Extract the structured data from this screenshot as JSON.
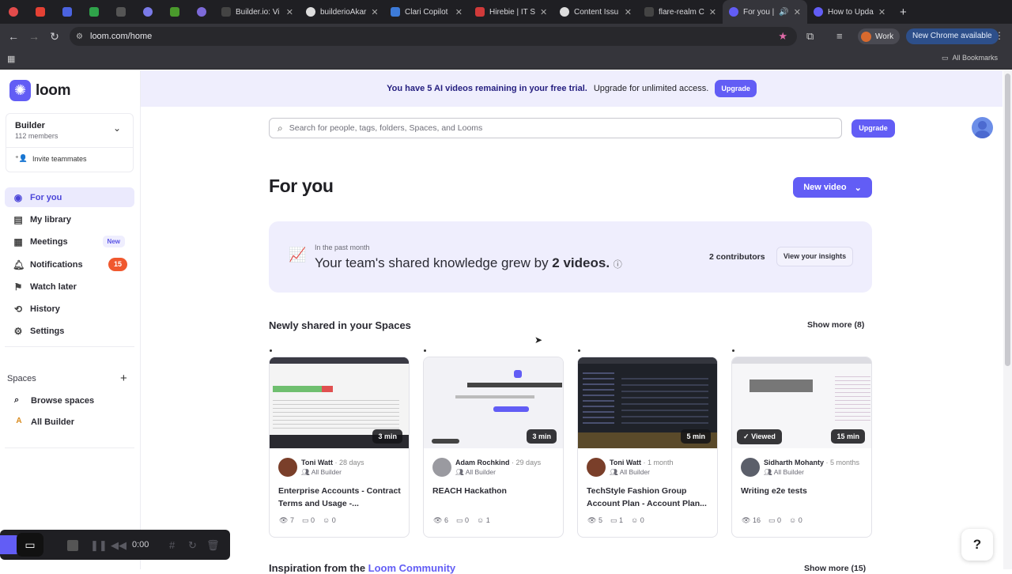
{
  "browser": {
    "tabs": [
      {
        "label": "",
        "color": "#e34b4b"
      },
      {
        "label": "",
        "color": "#e44134"
      },
      {
        "label": "",
        "color": "#4b63e0"
      },
      {
        "label": "",
        "color": "#2fa34a"
      },
      {
        "label": "",
        "color": "#555"
      },
      {
        "label": "",
        "color": "#7a7ae8"
      },
      {
        "label": "",
        "color": "#4a9a2c"
      },
      {
        "label": "",
        "color": "#7d6ad9"
      },
      {
        "label": "Builder.io: Vi",
        "color": "#444"
      },
      {
        "label": "builderioAkar",
        "color": "#ddd"
      },
      {
        "label": "Clari Copilot",
        "color": "#3d7bd9"
      },
      {
        "label": "Hirebie | IT S",
        "color": "#d03a3a"
      },
      {
        "label": "Content Issu",
        "color": "#ddd"
      },
      {
        "label": "flare-realm C",
        "color": "#444"
      },
      {
        "label": "For you |",
        "color": "#625df5"
      },
      {
        "label": "How to Upda",
        "color": "#625df5"
      }
    ],
    "url": "loom.com/home",
    "profile_label": "Work",
    "update_label": "New Chrome available",
    "bookmarks_label": "All Bookmarks"
  },
  "sidebar": {
    "logo_text": "loom",
    "workspace": {
      "name": "Builder",
      "members": "112 members",
      "invite": "Invite teammates"
    },
    "nav": [
      {
        "label": "For you",
        "icon": "person-icon"
      },
      {
        "label": "My library",
        "icon": "library-icon"
      },
      {
        "label": "Meetings",
        "icon": "calendar-icon",
        "badge": "New"
      },
      {
        "label": "Notifications",
        "icon": "bell-icon",
        "count": "15"
      },
      {
        "label": "Watch later",
        "icon": "bookmark-icon"
      },
      {
        "label": "History",
        "icon": "history-icon"
      },
      {
        "label": "Settings",
        "icon": "gear-icon"
      }
    ],
    "spaces_header": "Spaces",
    "spaces": [
      {
        "label": "Browse spaces",
        "icon": "search-icon"
      },
      {
        "label": "All Builder",
        "letter": "A"
      }
    ]
  },
  "recorder": {
    "time": "0:00"
  },
  "banner": {
    "bold_text": "You have 5 AI videos remaining in your free trial.",
    "text": "Upgrade for unlimited access.",
    "button": "Upgrade"
  },
  "search": {
    "placeholder": "Search for people, tags, folders, Spaces, and Looms",
    "upgrade": "Upgrade"
  },
  "main": {
    "title": "For you",
    "new_video": "New video",
    "insight": {
      "small": "In the past month",
      "big_prefix": "Your team's shared knowledge grew by ",
      "big_bold": "2 videos.",
      "contributors": "2 contributors",
      "button": "View your insights"
    },
    "section_title": "Newly shared in your Spaces",
    "show_more": "Show more (8)",
    "cards": [
      {
        "duration": "3 min",
        "author": "Toni Watt",
        "age": "28 days",
        "space": "All Builder",
        "title": "Enterprise Accounts - Contract Terms and Usage -...",
        "views": "7",
        "comments": "0",
        "reactions": "0",
        "viewed": ""
      },
      {
        "duration": "3 min",
        "author": "Adam Rochkind",
        "age": "29 days",
        "space": "All Builder",
        "title": "REACH Hackathon",
        "views": "6",
        "comments": "0",
        "reactions": "1",
        "viewed": ""
      },
      {
        "duration": "5 min",
        "author": "Toni Watt",
        "age": "1 month",
        "space": "All Builder",
        "title": "TechStyle Fashion Group Account Plan - Account Plan...",
        "views": "5",
        "comments": "1",
        "reactions": "0",
        "viewed": ""
      },
      {
        "duration": "15 min",
        "author": "Sidharth Mohanty",
        "age": "5 months",
        "space": "All Builder",
        "title": "Writing e2e tests",
        "views": "16",
        "comments": "0",
        "reactions": "0",
        "viewed": "Viewed"
      }
    ],
    "inspiration_prefix": "Inspiration from the ",
    "inspiration_link": "Loom Community",
    "show_more2": "Show more (15)"
  },
  "colors": {
    "accent": "#625df5",
    "badge": "#f0582e"
  }
}
